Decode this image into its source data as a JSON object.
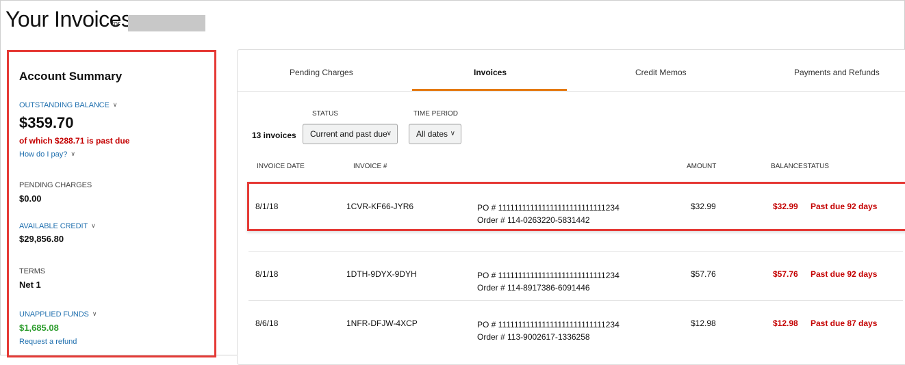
{
  "header": {
    "title": "Your Invoices",
    "title_suffix": "for"
  },
  "summary": {
    "title": "Account Summary",
    "outstanding_label": "OUTSTANDING BALANCE",
    "outstanding_value": "$359.70",
    "past_due_text": "of which $288.71 is past due",
    "how_to_pay": "How do I pay?",
    "pending_label": "PENDING CHARGES",
    "pending_value": "$0.00",
    "credit_label": "AVAILABLE CREDIT",
    "credit_value": "$29,856.80",
    "terms_label": "TERMS",
    "terms_value": "Net 1",
    "unapplied_label": "UNAPPLIED FUNDS",
    "unapplied_value": "$1,685.08",
    "refund_link": "Request a refund"
  },
  "tabs": [
    {
      "label": "Pending Charges",
      "active": false
    },
    {
      "label": "Invoices",
      "active": true
    },
    {
      "label": "Credit Memos",
      "active": false
    },
    {
      "label": "Payments and Refunds",
      "active": false
    }
  ],
  "filters": {
    "count": "13 invoices",
    "status_label": "STATUS",
    "status_value": "Current and past due",
    "period_label": "TIME PERIOD",
    "period_value": "All dates"
  },
  "table": {
    "columns": [
      "INVOICE DATE",
      "INVOICE #",
      "AMOUNT",
      "BALANCE",
      "STATUS"
    ],
    "rows": [
      {
        "date": "8/1/18",
        "invoice": "1CVR-KF66-JYR6",
        "po": "PO # 111111111111111111111111111234",
        "order": "Order # 114-0263220-5831442",
        "amount": "$32.99",
        "balance": "$32.99",
        "status": "Past due 92 days"
      },
      {
        "date": "8/1/18",
        "invoice": "1DTH-9DYX-9DYH",
        "po": "PO # 111111111111111111111111111234",
        "order": "Order # 114-8917386-6091446",
        "amount": "$57.76",
        "balance": "$57.76",
        "status": "Past due 92 days"
      },
      {
        "date": "8/6/18",
        "invoice": "1NFR-DFJW-4XCP",
        "po": "PO # 111111111111111111111111111234",
        "order": "Order # 113-9002617-1336258",
        "amount": "$12.98",
        "balance": "$12.98",
        "status": "Past due 87 days"
      }
    ]
  },
  "colors": {
    "accent_tab": "#e47911",
    "link": "#1f6fae",
    "past_due": "#c40000",
    "positive": "#2e9d2e",
    "highlight_border": "#e53935"
  },
  "icons": {
    "chevron": "chevron-down-icon"
  }
}
